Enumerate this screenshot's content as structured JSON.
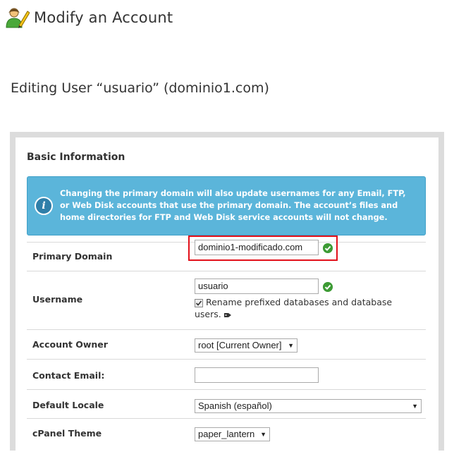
{
  "header": {
    "title": "Modify an Account"
  },
  "subtitle": "Editing User “usuario” (dominio1.com)",
  "panel": {
    "title": "Basic Information",
    "alert": "Changing the primary domain will also update usernames for any Email, FTP, or Web Disk accounts that use the primary domain. The account’s files and home directories for FTP and Web Disk service accounts will not change."
  },
  "form": {
    "primary_domain": {
      "label": "Primary Domain",
      "value": "dominio1-modificado.com"
    },
    "username": {
      "label": "Username",
      "value": "usuario",
      "rename_label": "Rename prefixed databases and database users.",
      "rename_checked": true
    },
    "account_owner": {
      "label": "Account Owner",
      "value": "root [Current Owner]"
    },
    "contact_email": {
      "label": "Contact Email:",
      "value": ""
    },
    "default_locale": {
      "label": "Default Locale",
      "value": "Spanish (español)"
    },
    "cpanel_theme": {
      "label": "cPanel Theme",
      "value": "paper_lantern"
    }
  },
  "colors": {
    "alert_bg": "#5bb5da",
    "highlight": "#e2101a",
    "valid": "#3d9b35"
  }
}
